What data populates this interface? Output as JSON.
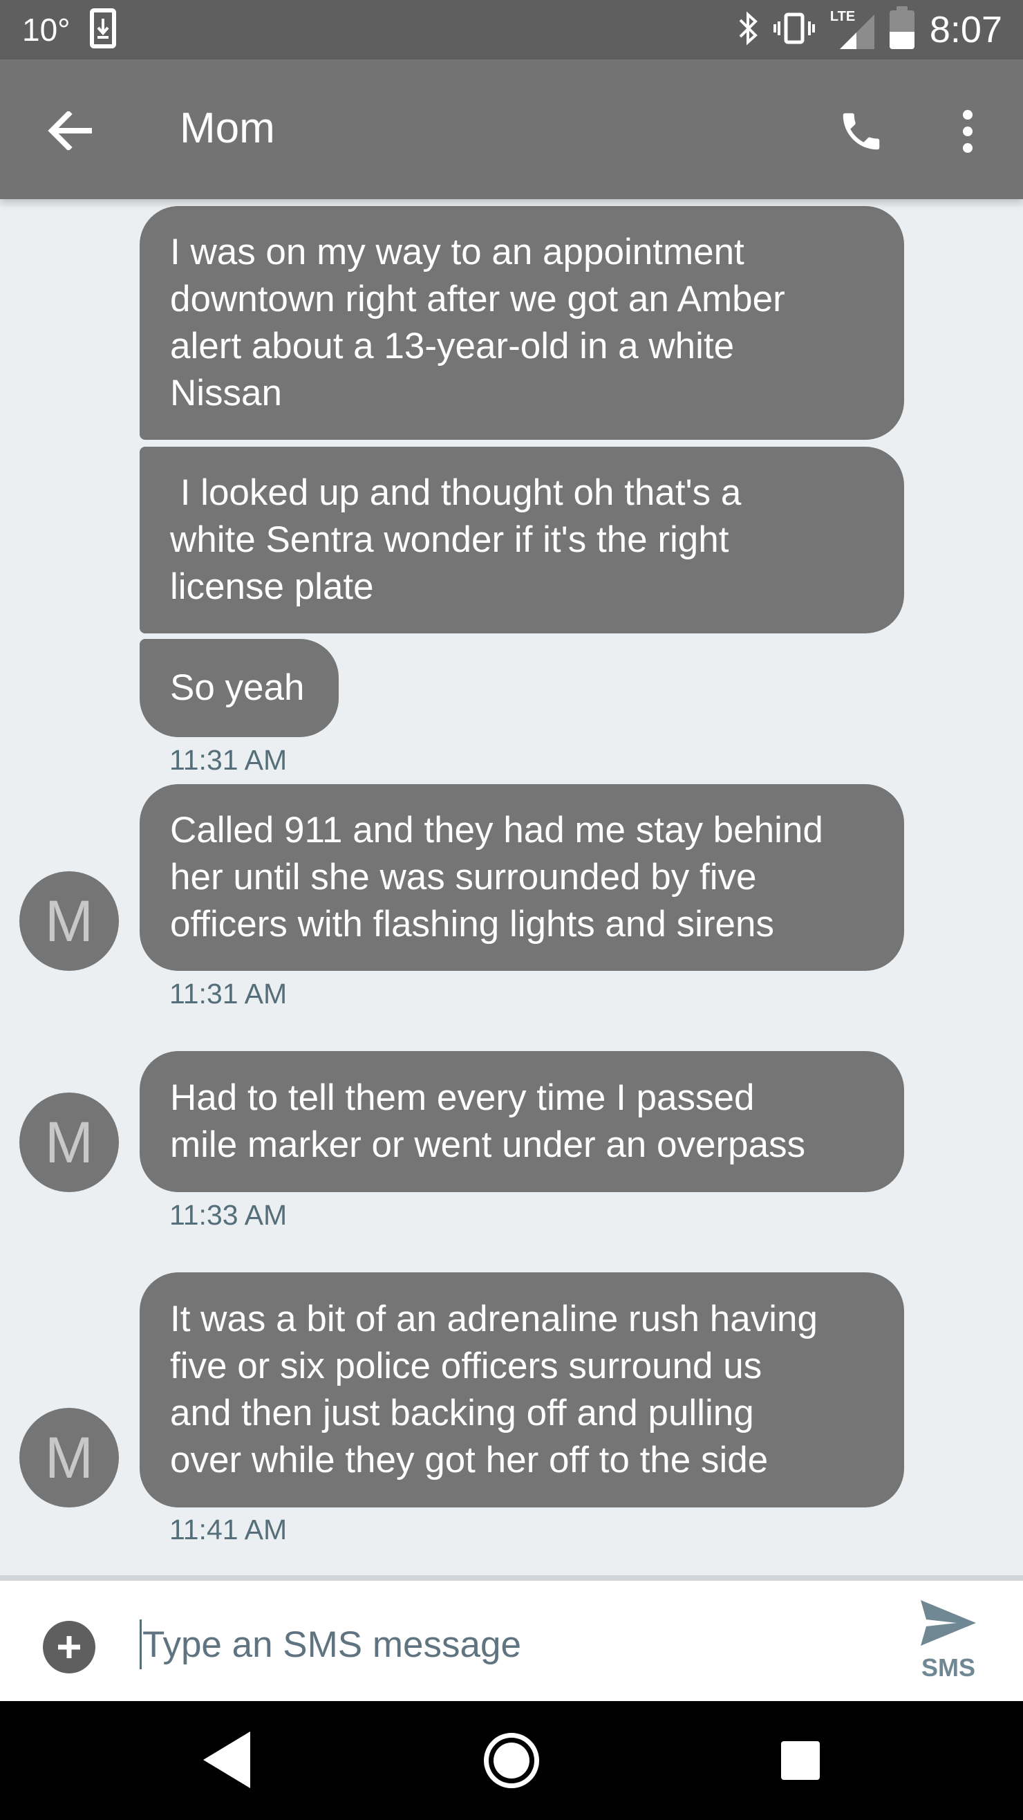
{
  "status_bar": {
    "temperature": "10°",
    "network": "LTE",
    "time": "8:07",
    "battery_level": 0.45,
    "icons": [
      "download-notification-icon",
      "bluetooth-icon",
      "vibrate-icon",
      "signal-icon",
      "battery-icon"
    ]
  },
  "app_bar": {
    "title": "Mom",
    "icons": [
      "back-arrow-icon",
      "phone-icon",
      "more-vert-icon"
    ]
  },
  "contact": {
    "avatar_initial": "M"
  },
  "messages": [
    {
      "text": "I was on my way to an appointment\ndowntown right after we got an Amber\nalert about a 13-year-old in a white\nNissan"
    },
    {
      "text": " I looked up and thought oh that's a\nwhite Sentra wonder if it's the right\nlicense plate"
    },
    {
      "text": "So yeah",
      "time": "11:31 AM"
    },
    {
      "text": "Called 911 and they had me stay behind\nher until she was surrounded by five\nofficers with flashing lights and sirens",
      "time": "11:31 AM"
    },
    {
      "text": "Had to tell them every time I passed\nmile marker or went under an overpass",
      "time": "11:33 AM"
    },
    {
      "text": "It was a bit of an adrenaline rush having\nfive or six police officers surround us\nand then just backing off and pulling\nover while they got her off to the side",
      "time": "11:41 AM"
    }
  ],
  "compose": {
    "placeholder": "Type an SMS message",
    "value": "",
    "send_label": "SMS",
    "icons": [
      "add-circle-icon",
      "send-icon"
    ]
  },
  "nav_bar": {
    "icons": [
      "nav-back-icon",
      "nav-home-icon",
      "nav-recents-icon"
    ]
  },
  "colors": {
    "status_bar": "#5f5f5f",
    "app_bar": "#737373",
    "background": "#eceff1",
    "bubble": "#757575",
    "timestamp": "#546e7a",
    "send_accent": "#6f8893"
  }
}
